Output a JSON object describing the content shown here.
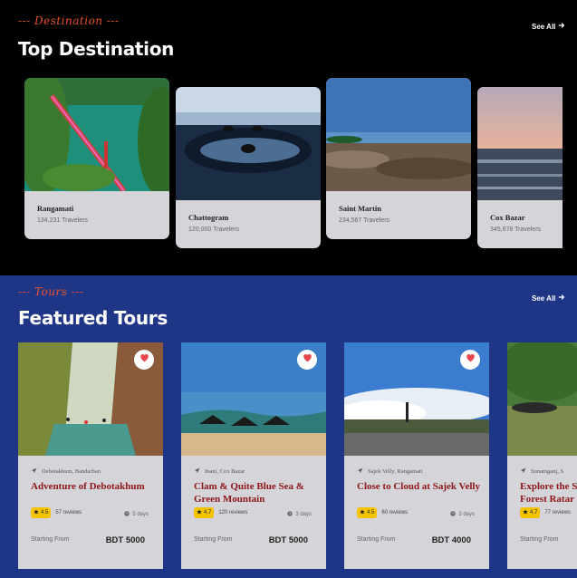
{
  "destinations": {
    "eyebrow": "--- Destination ---",
    "title": "Top Destination",
    "see_all": "See All",
    "items": [
      {
        "name": "Rangamati",
        "travelers": "134,231 Travelers"
      },
      {
        "name": "Chattogram",
        "travelers": "120,000 Travelers"
      },
      {
        "name": "Saint Martin",
        "travelers": "234,567 Travelers"
      },
      {
        "name": "Cox Bazar",
        "travelers": "345,678 Travelers"
      }
    ]
  },
  "tours": {
    "eyebrow": "--- Tours ---",
    "title": "Featured Tours",
    "see_all": "See All",
    "items": [
      {
        "location": "Debotakhum, Bandarban",
        "title": "Adventure of Debotakhum",
        "rating": "4.5",
        "reviews": "57 reviews",
        "days": "5 days",
        "starting": "Starting From",
        "price": "BDT 5000"
      },
      {
        "location": "Inani, Cox Bazar",
        "title": "Clam & Quite Blue Sea & Green Mountain",
        "rating": "4.7",
        "reviews": "120 reviews",
        "days": "3 days",
        "starting": "Starting From",
        "price": "BDT 5000"
      },
      {
        "location": "Sajek Velly, Rangamati",
        "title": "Close to Cloud at Sajek Velly",
        "rating": "4.5",
        "reviews": "60 reviews",
        "days": "3 days",
        "starting": "Starting From",
        "price": "BDT 4000"
      },
      {
        "location": "Sunamganj, S",
        "title": "Explore the S Forest Ratar",
        "rating": "4.7",
        "reviews": "77 reviews",
        "days": "",
        "starting": "Starting From",
        "price": ""
      }
    ]
  },
  "colors": {
    "accent": "#e8522a",
    "tours_bg": "#1f3586",
    "title_red": "#8f1618",
    "rating_yellow": "#f4c400",
    "heart": "#e5484d"
  },
  "icons": {
    "see_all": "arrow-right-icon",
    "favorite": "heart-icon",
    "location": "location-arrow-icon",
    "rating": "star-icon",
    "duration": "clock-icon"
  }
}
